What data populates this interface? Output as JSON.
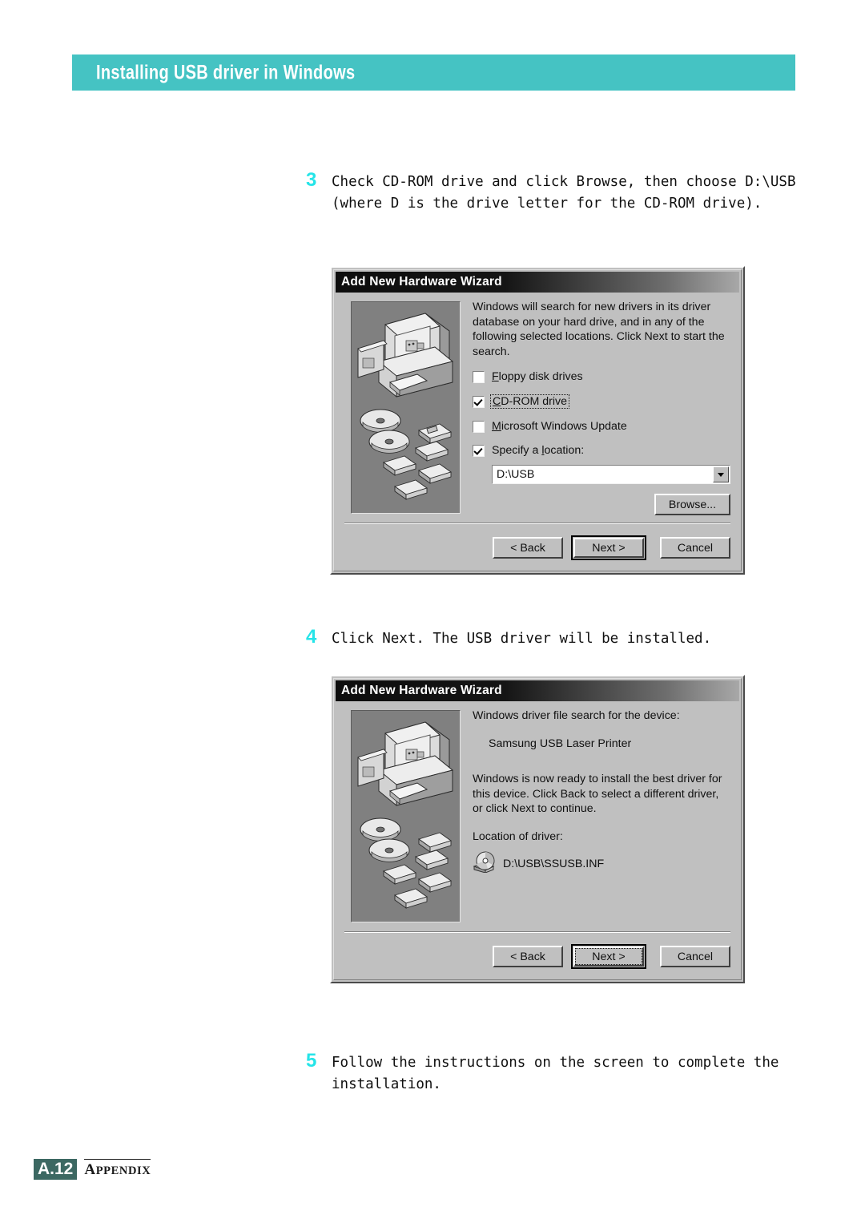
{
  "header": {
    "title": "Installing USB driver in Windows",
    "banner_color": "#45c3c3"
  },
  "steps": [
    {
      "number": "3",
      "text": "Check CD-ROM drive and click Browse, then choose D:\\USB\n(where D is the drive letter for the CD-ROM drive)."
    },
    {
      "number": "4",
      "text": "Click Next. The USB driver will be installed."
    },
    {
      "number": "5",
      "text": "Follow the instructions on the screen to complete the\ninstallation."
    }
  ],
  "dialog1": {
    "title": "Add New Hardware Wizard",
    "illustration_name": "computer-media-illustration",
    "body_text": "Windows will search for new drivers in its driver database on your hard drive, and in any of the following selected locations. Click Next to start the search.",
    "checkboxes": [
      {
        "label": "Floppy disk drives",
        "accel": "F",
        "checked": false,
        "focused": false
      },
      {
        "label": "CD-ROM drive",
        "accel": "C",
        "checked": true,
        "focused": true
      },
      {
        "label": "Microsoft Windows Update",
        "accel": "M",
        "checked": false,
        "focused": false
      },
      {
        "label": "Specify a location:",
        "accel": "l",
        "checked": true,
        "focused": false
      }
    ],
    "location_combo": {
      "value": "D:\\USB",
      "placeholder": "D:\\USB"
    },
    "browse_label": "Browse...",
    "buttons": {
      "back": "< Back",
      "back_accel": "B",
      "next": "Next >",
      "cancel": "Cancel",
      "default": "next"
    }
  },
  "dialog2": {
    "title": "Add New Hardware Wizard",
    "illustration_name": "computer-media-illustration",
    "search_label": "Windows driver file search for the device:",
    "device_name": "Samsung USB Laser Printer",
    "ready_text": "Windows is now ready to install the best driver for this device. Click Back to select a different driver, or click Next to continue.",
    "location_label": "Location of driver:",
    "driver_path": "D:\\USB\\SSUSB.INF",
    "driver_icon": "cdrom-drive-icon",
    "buttons": {
      "back": "< Back",
      "back_accel": "B",
      "next": "Next >",
      "cancel": "Cancel",
      "default": "next",
      "focused": "next"
    }
  },
  "footer": {
    "page": "A.12",
    "section": "Appendix",
    "page_box_color": "#3c6862"
  }
}
